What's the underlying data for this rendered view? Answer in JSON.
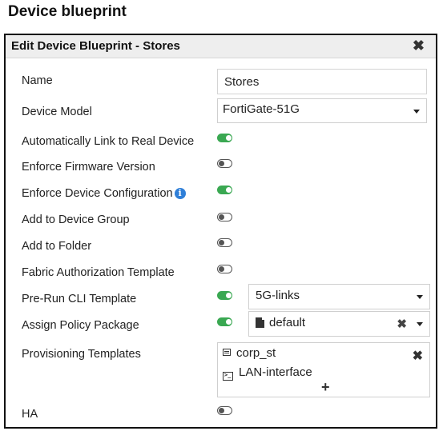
{
  "page": {
    "heading": "Device blueprint"
  },
  "dialog": {
    "title": "Edit Device Blueprint - Stores",
    "close_symbol": "✖",
    "accent_on_color": "#3aa852",
    "info_color": "#2f7fd8",
    "fields": {
      "name": {
        "label": "Name",
        "value": "Stores"
      },
      "device_model": {
        "label": "Device Model",
        "value": "FortiGate-51G"
      },
      "auto_link": {
        "label": "Automatically Link to Real Device",
        "enabled": true
      },
      "enforce_firmware": {
        "label": "Enforce Firmware Version",
        "enabled": false
      },
      "enforce_config": {
        "label": "Enforce Device Configuration",
        "enabled": true,
        "info_icon": "info-icon",
        "info_glyph": "i"
      },
      "device_group": {
        "label": "Add to Device Group",
        "enabled": false
      },
      "folder": {
        "label": "Add to Folder",
        "enabled": false
      },
      "fabric_auth": {
        "label": "Fabric Authorization Template",
        "enabled": false
      },
      "pre_run_cli": {
        "label": "Pre-Run CLI Template",
        "enabled": true,
        "value": "5G-links"
      },
      "policy_package": {
        "label": "Assign Policy Package",
        "enabled": true,
        "value": "default",
        "clear_symbol": "✖"
      },
      "provisioning": {
        "label": "Provisioning Templates",
        "items": [
          {
            "icon": "template-icon",
            "text": "corp_st"
          },
          {
            "icon": "cli-script-icon",
            "text": "LAN-interface",
            "icon_glyph": ">_"
          }
        ],
        "remove_symbol": "✖",
        "add_symbol": "+"
      },
      "ha": {
        "label": "HA",
        "enabled": false
      }
    }
  }
}
